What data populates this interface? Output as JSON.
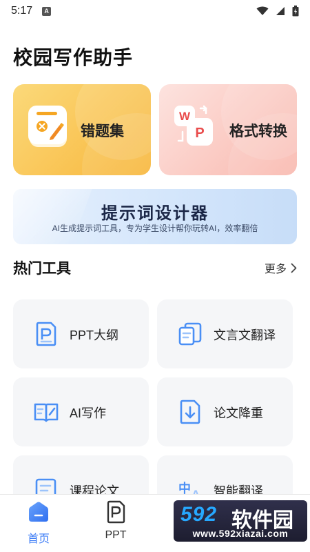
{
  "status_bar": {
    "time": "5:17",
    "notification_letter": "A"
  },
  "app_title": "校园写作助手",
  "feature_cards": [
    {
      "label": "错题集",
      "icon": "error-notebook-icon"
    },
    {
      "label": "格式转换",
      "icon": "word-to-pdf-convert-icon"
    }
  ],
  "banner": {
    "title": "提示词设计器",
    "subtitle": "AI生成提示词工具，专为学生设计帮你玩转AI，效率翻倍"
  },
  "hot_tools": {
    "title": "热门工具",
    "more_label": "更多",
    "items": [
      {
        "label": "PPT大纲",
        "icon": "ppt-outline-icon"
      },
      {
        "label": "文言文翻译",
        "icon": "classical-translate-icon"
      },
      {
        "label": "AI写作",
        "icon": "ai-writing-icon"
      },
      {
        "label": "论文降重",
        "icon": "paper-rewrite-icon"
      },
      {
        "label": "课程论文",
        "icon": "course-paper-icon"
      },
      {
        "label": "智能翻译",
        "icon": "smart-translate-icon"
      }
    ]
  },
  "bottom_nav": [
    {
      "label": "首页",
      "icon": "home-icon",
      "active": true
    },
    {
      "label": "PPT",
      "icon": "ppt-icon",
      "active": false
    }
  ],
  "watermark": {
    "brand_number": "592",
    "brand_text": "软件园",
    "url": "www.592xiazai.com"
  },
  "colors": {
    "accent": "#3b7bf6",
    "card_yellow": "#f8b63b",
    "card_pink": "#f9b8ae",
    "tool_bg": "#f5f6f8"
  }
}
